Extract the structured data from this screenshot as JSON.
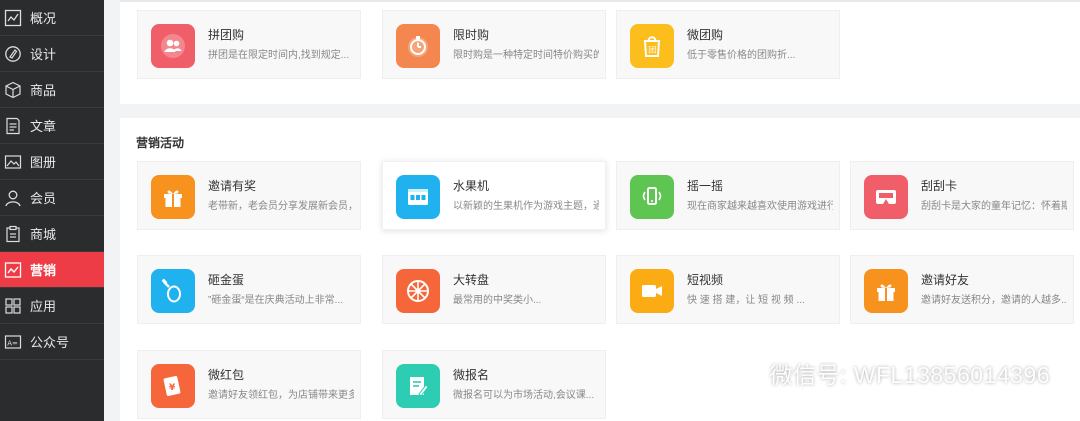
{
  "sidebar": {
    "items": [
      {
        "label": "概况",
        "icon": "chart-icon"
      },
      {
        "label": "设计",
        "icon": "design-icon"
      },
      {
        "label": "商品",
        "icon": "cube-icon"
      },
      {
        "label": "文章",
        "icon": "article-icon"
      },
      {
        "label": "图册",
        "icon": "image-icon"
      },
      {
        "label": "会员",
        "icon": "user-icon"
      },
      {
        "label": "商城",
        "icon": "clipboard-icon"
      },
      {
        "label": "营销",
        "icon": "trend-icon",
        "active": true
      },
      {
        "label": "应用",
        "icon": "apps-icon"
      },
      {
        "label": "公众号",
        "icon": "account-icon"
      }
    ]
  },
  "top_cards": [
    {
      "title": "拼团购",
      "desc": "拼团是在限定时间内,找到规定...",
      "color": "#f05e69",
      "icon": "group-icon"
    },
    {
      "title": "限时购",
      "desc": "限时购是一种特定时间特价购买的",
      "color": "#f3874f",
      "icon": "timer-icon"
    },
    {
      "title": "微团购",
      "desc": "低于零售价格的团购折...",
      "color": "#fbbe1c",
      "icon": "shopping-bag-icon"
    }
  ],
  "marketing": {
    "section_title": "营销活动",
    "cards": [
      {
        "title": "邀请有奖",
        "desc": "老带新，老会员分享发展新会员，双",
        "color": "#f7921e",
        "icon": "gift-icon"
      },
      {
        "title": "水果机",
        "desc": "以新颖的生果机作为游戏主题，通",
        "color": "#1fb2ee",
        "icon": "slot-machine-icon"
      },
      {
        "title": "摇一摇",
        "desc": "现在商家越来越喜欢使用游戏进行",
        "color": "#5ec552",
        "icon": "shake-phone-icon"
      },
      {
        "title": "刮刮卡",
        "desc": "刮刮卡是大家的童年记忆：怀着期",
        "color": "#f05e69",
        "icon": "scratch-card-icon"
      },
      {
        "title": "砸金蛋",
        "desc": "”砸金蛋“是在庆典活动上非常...",
        "color": "#1fb2ee",
        "icon": "hammer-egg-icon"
      },
      {
        "title": "大转盘",
        "desc": "最常用的中奖类小...",
        "color": "#f5663b",
        "icon": "wheel-icon"
      },
      {
        "title": "短视频",
        "desc": "快 速 搭 建，让 短 视 频 ...",
        "color": "#fbab13",
        "icon": "video-icon"
      },
      {
        "title": "邀请好友",
        "desc": "邀请好友送积分，邀请的人越多...",
        "color": "#f7921e",
        "icon": "gift-icon"
      },
      {
        "title": "微红包",
        "desc": "邀请好友领红包，为店铺带来更多流",
        "color": "#f5663b",
        "icon": "red-packet-icon"
      },
      {
        "title": "微报名",
        "desc": "微报名可以为市场活动,会议课...",
        "color": "#2ccdb2",
        "icon": "signup-icon"
      }
    ]
  },
  "watermark": {
    "text": "微信号: WFL13856014396"
  }
}
